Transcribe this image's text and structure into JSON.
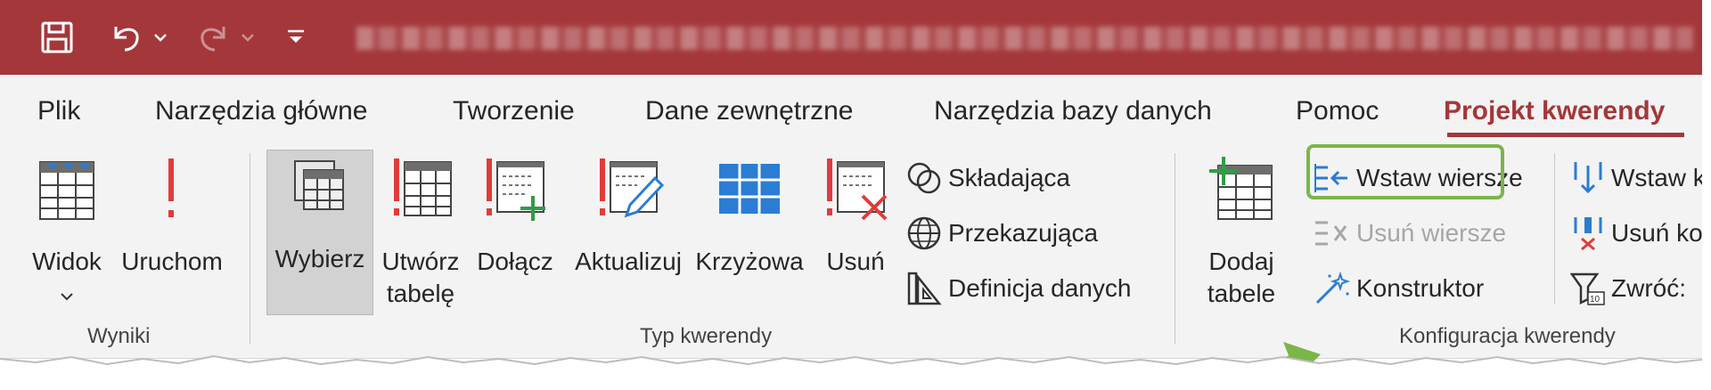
{
  "colors": {
    "accent": "#a4373a",
    "ribbon_bg": "#f3f3f3",
    "highlight": "#7ab648",
    "selected_bg": "#d2d2d2"
  },
  "quick_access": {
    "icons": [
      "save-icon",
      "undo-icon",
      "redo-icon",
      "customize-icon"
    ]
  },
  "tabs": [
    {
      "label": "Plik"
    },
    {
      "label": "Narzędzia główne"
    },
    {
      "label": "Tworzenie"
    },
    {
      "label": "Dane zewnętrzne"
    },
    {
      "label": "Narzędzia bazy danych"
    },
    {
      "label": "Pomoc"
    },
    {
      "label": "Projekt kwerendy",
      "active": true
    }
  ],
  "groups": {
    "wyniki": {
      "label": "Wyniki",
      "widok": "Widok",
      "uruchom": "Uruchom"
    },
    "typ_kwerendy": {
      "label": "Typ kwerendy",
      "wybierz": "Wybierz",
      "utworz_line1": "Utwórz",
      "utworz_line2": "tabelę",
      "dolacz": "Dołącz",
      "aktualizuj": "Aktualizuj",
      "krzyzowa": "Krzyżowa",
      "usun": "Usuń",
      "skladajaca": "Składająca",
      "przekazujaca": "Przekazująca",
      "definicja": "Definicja danych"
    },
    "konfiguracja": {
      "label": "Konfiguracja kwerendy",
      "dodaj_line1": "Dodaj",
      "dodaj_line2": "tabele",
      "wstaw_wiersze": "Wstaw wiersze",
      "usun_wiersze": "Usuń wiersze",
      "konstruktor": "Konstruktor",
      "wstaw_k": "Wstaw k",
      "usun_ko": "Usuń ko",
      "zwroc": "Zwróć:"
    }
  }
}
